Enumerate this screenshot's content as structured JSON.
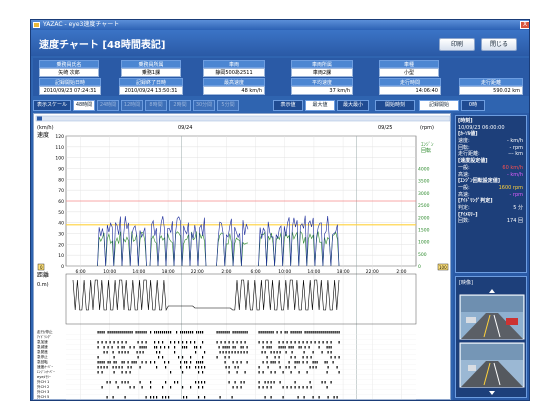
{
  "window": {
    "title": "YAZAC - eye3速度チャート",
    "close": "X"
  },
  "header": {
    "title": "速度チャート [48時間表記]",
    "print_label": "印刷",
    "close_label": "閉じる"
  },
  "info": {
    "row1": [
      {
        "label": "乗務員氏名",
        "value": "矢崎 次郎"
      },
      {
        "label": "乗務員所属",
        "value": "乗務1課"
      },
      {
        "label": "車両",
        "value": "静岡500あ2511"
      },
      {
        "label": "車両所属",
        "value": "車両2課"
      },
      {
        "label": "車種",
        "value": "小型"
      }
    ],
    "row2": [
      {
        "label": "記録開始日時",
        "value": "2010/09/23 07:24:31"
      },
      {
        "label": "記録終了日時",
        "value": "2010/09/24 13:50:31"
      },
      {
        "label": "最高速度",
        "value": "48 km/h"
      },
      {
        "label": "平均速度",
        "value": "37 km/h"
      },
      {
        "label": "走行時間",
        "value": "14:06:40"
      },
      {
        "label": "走行距離",
        "value": "590.02 km"
      }
    ]
  },
  "toolbar": {
    "scale_label": "表示スケール",
    "scales": [
      "48時間",
      "24時間",
      "12時間",
      "8時間",
      "2時間",
      "30分間",
      "5分間"
    ],
    "display_label": "表示値",
    "max_label": "最大値",
    "max_min_label": "最大最小",
    "start_label": "開始時刻",
    "record_start_label": "記録開始",
    "record_start_value": "0時"
  },
  "chart_data": {
    "type": "line",
    "title": "",
    "dates": [
      "09/24",
      "09/25"
    ],
    "left_unit": "(km/h)",
    "left_label": "速度",
    "right_unit": "(rpm)",
    "right_label1": "ｴﾝｼﾞﾝ",
    "right_label2": "回転",
    "ylim": [
      0,
      120
    ],
    "yticks": [
      120,
      110,
      100,
      90,
      80,
      70,
      60,
      50,
      40,
      30,
      20,
      10,
      0
    ],
    "rticks": [
      4000,
      3500,
      3000,
      2500,
      2000,
      1500,
      1000,
      500,
      0
    ],
    "xticks": [
      "6:00",
      "10:00",
      "14:00",
      "18:00",
      "22:00",
      "2:00",
      "6:00",
      "10:00",
      "14:00",
      "18:00",
      "22:00",
      "2:00"
    ],
    "speed_limit_red": 60,
    "speed_limit_yellow": 38,
    "distance_label": "距離",
    "distance_unit": "0.m)",
    "event_labels": [
      "走行/停止",
      "ｱｲﾄﾞﾘﾝｸﾞ",
      "急加速",
      "急減速",
      "急発進",
      "急停止",
      "急回転",
      "速度ｵｰﾊﾞｰ",
      "ｴﾝｼﾞﾝｵｰﾊﾞｰ",
      "eyeﾒﾓﾘｰ",
      "外CH 1",
      "外CH 2",
      "外CH 3",
      "外CH 5"
    ],
    "series": [
      {
        "name": "速度",
        "color": "#1a2a9a"
      },
      {
        "name": "ｴﾝｼﾞﾝ回転",
        "color": "#2c8a2c"
      }
    ],
    "legend_speed_code": "0",
    "legend_rpm_code": "100"
  },
  "side": {
    "time_label": "[時刻]",
    "time_value": "10/09/23 06:00:00",
    "cursor_header": "[ｶｰｿﾙ値]",
    "speed_label": "速度:",
    "speed_value": "- km/h",
    "rev_label": "回転:",
    "rev_value": "- rpm",
    "dist_label": "走行距離:",
    "dist_value": "--- km",
    "speedset_header": "[速度設定値]",
    "general1_label": "一般:",
    "general1_value": "60 km/h",
    "highway1_label": "高速:",
    "highway1_value": "- km/h",
    "engset_header": "[ｴﾝｼﾞﾝ回転設定値]",
    "general2_label": "一般:",
    "general2_value": "1600 rpm",
    "highway2_label": "高速:",
    "highway2_value": "- rpm",
    "idle_header": "[ｱｲﾄﾞﾘﾝｸﾞ判定]",
    "idle_label": "判定:",
    "idle_value": "5 分",
    "memory_header": "[ｱｲﾒﾓﾘｰ]",
    "count_label": "回数:",
    "count_value": "174 回",
    "video_label": "[映像]",
    "colors": {
      "red": "#ff5050",
      "yellow": "#ffd23c",
      "magenta": "#e05cff",
      "white": "#ffffff"
    }
  }
}
